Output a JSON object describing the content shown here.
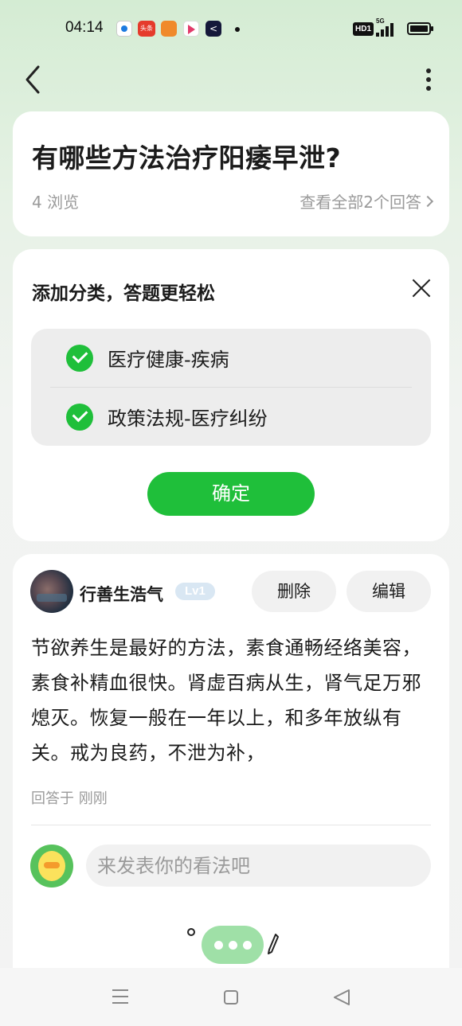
{
  "status_bar": {
    "time": "04:14",
    "notif_toutiao": "头条",
    "network_badge": "HD1",
    "network_type": "5G"
  },
  "question": {
    "title": "有哪些方法治疗阳痿早泄?",
    "views": "4 浏览",
    "view_all": "查看全部2个回答"
  },
  "category_prompt": {
    "title": "添加分类，答题更轻松",
    "items": [
      {
        "label": "医疗健康-疾病",
        "checked": true
      },
      {
        "label": "政策法规-医疗纠纷",
        "checked": true
      }
    ],
    "confirm_label": "确定"
  },
  "answer": {
    "username": "行善生浩气",
    "level": "Lv1",
    "delete_label": "删除",
    "edit_label": "编辑",
    "text": "节欲养生是最好的方法，素食通畅经络美容，素食补精血很快。肾虚百病从生，肾气足万邪熄灭。恢复一般在一年以上，和多年放纵有关。戒为良药，不泄为补，",
    "time": "回答于 刚刚"
  },
  "comment": {
    "placeholder": "来发表你的看法吧"
  },
  "colors": {
    "accent_green": "#1fbf3a",
    "background_top": "#d4ecd3"
  }
}
